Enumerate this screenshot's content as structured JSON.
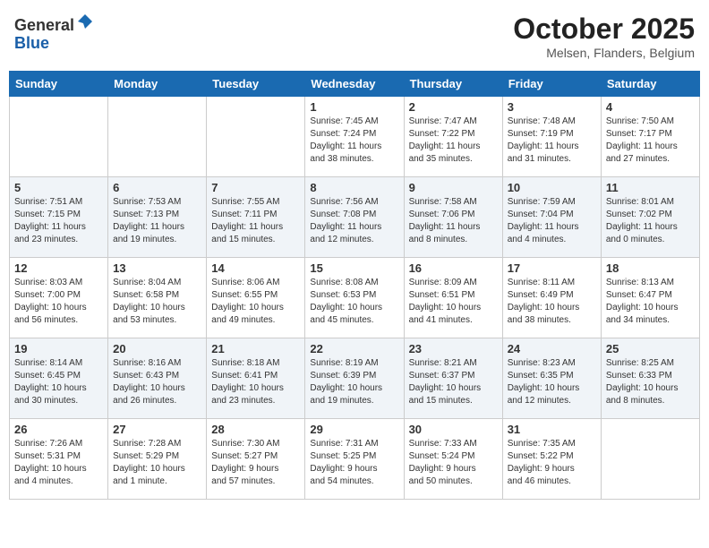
{
  "header": {
    "logo_line1": "General",
    "logo_line2": "Blue",
    "month_title": "October 2025",
    "location": "Melsen, Flanders, Belgium"
  },
  "days_of_week": [
    "Sunday",
    "Monday",
    "Tuesday",
    "Wednesday",
    "Thursday",
    "Friday",
    "Saturday"
  ],
  "weeks": [
    [
      {
        "day": "",
        "info": ""
      },
      {
        "day": "",
        "info": ""
      },
      {
        "day": "",
        "info": ""
      },
      {
        "day": "1",
        "info": "Sunrise: 7:45 AM\nSunset: 7:24 PM\nDaylight: 11 hours\nand 38 minutes."
      },
      {
        "day": "2",
        "info": "Sunrise: 7:47 AM\nSunset: 7:22 PM\nDaylight: 11 hours\nand 35 minutes."
      },
      {
        "day": "3",
        "info": "Sunrise: 7:48 AM\nSunset: 7:19 PM\nDaylight: 11 hours\nand 31 minutes."
      },
      {
        "day": "4",
        "info": "Sunrise: 7:50 AM\nSunset: 7:17 PM\nDaylight: 11 hours\nand 27 minutes."
      }
    ],
    [
      {
        "day": "5",
        "info": "Sunrise: 7:51 AM\nSunset: 7:15 PM\nDaylight: 11 hours\nand 23 minutes."
      },
      {
        "day": "6",
        "info": "Sunrise: 7:53 AM\nSunset: 7:13 PM\nDaylight: 11 hours\nand 19 minutes."
      },
      {
        "day": "7",
        "info": "Sunrise: 7:55 AM\nSunset: 7:11 PM\nDaylight: 11 hours\nand 15 minutes."
      },
      {
        "day": "8",
        "info": "Sunrise: 7:56 AM\nSunset: 7:08 PM\nDaylight: 11 hours\nand 12 minutes."
      },
      {
        "day": "9",
        "info": "Sunrise: 7:58 AM\nSunset: 7:06 PM\nDaylight: 11 hours\nand 8 minutes."
      },
      {
        "day": "10",
        "info": "Sunrise: 7:59 AM\nSunset: 7:04 PM\nDaylight: 11 hours\nand 4 minutes."
      },
      {
        "day": "11",
        "info": "Sunrise: 8:01 AM\nSunset: 7:02 PM\nDaylight: 11 hours\nand 0 minutes."
      }
    ],
    [
      {
        "day": "12",
        "info": "Sunrise: 8:03 AM\nSunset: 7:00 PM\nDaylight: 10 hours\nand 56 minutes."
      },
      {
        "day": "13",
        "info": "Sunrise: 8:04 AM\nSunset: 6:58 PM\nDaylight: 10 hours\nand 53 minutes."
      },
      {
        "day": "14",
        "info": "Sunrise: 8:06 AM\nSunset: 6:55 PM\nDaylight: 10 hours\nand 49 minutes."
      },
      {
        "day": "15",
        "info": "Sunrise: 8:08 AM\nSunset: 6:53 PM\nDaylight: 10 hours\nand 45 minutes."
      },
      {
        "day": "16",
        "info": "Sunrise: 8:09 AM\nSunset: 6:51 PM\nDaylight: 10 hours\nand 41 minutes."
      },
      {
        "day": "17",
        "info": "Sunrise: 8:11 AM\nSunset: 6:49 PM\nDaylight: 10 hours\nand 38 minutes."
      },
      {
        "day": "18",
        "info": "Sunrise: 8:13 AM\nSunset: 6:47 PM\nDaylight: 10 hours\nand 34 minutes."
      }
    ],
    [
      {
        "day": "19",
        "info": "Sunrise: 8:14 AM\nSunset: 6:45 PM\nDaylight: 10 hours\nand 30 minutes."
      },
      {
        "day": "20",
        "info": "Sunrise: 8:16 AM\nSunset: 6:43 PM\nDaylight: 10 hours\nand 26 minutes."
      },
      {
        "day": "21",
        "info": "Sunrise: 8:18 AM\nSunset: 6:41 PM\nDaylight: 10 hours\nand 23 minutes."
      },
      {
        "day": "22",
        "info": "Sunrise: 8:19 AM\nSunset: 6:39 PM\nDaylight: 10 hours\nand 19 minutes."
      },
      {
        "day": "23",
        "info": "Sunrise: 8:21 AM\nSunset: 6:37 PM\nDaylight: 10 hours\nand 15 minutes."
      },
      {
        "day": "24",
        "info": "Sunrise: 8:23 AM\nSunset: 6:35 PM\nDaylight: 10 hours\nand 12 minutes."
      },
      {
        "day": "25",
        "info": "Sunrise: 8:25 AM\nSunset: 6:33 PM\nDaylight: 10 hours\nand 8 minutes."
      }
    ],
    [
      {
        "day": "26",
        "info": "Sunrise: 7:26 AM\nSunset: 5:31 PM\nDaylight: 10 hours\nand 4 minutes."
      },
      {
        "day": "27",
        "info": "Sunrise: 7:28 AM\nSunset: 5:29 PM\nDaylight: 10 hours\nand 1 minute."
      },
      {
        "day": "28",
        "info": "Sunrise: 7:30 AM\nSunset: 5:27 PM\nDaylight: 9 hours\nand 57 minutes."
      },
      {
        "day": "29",
        "info": "Sunrise: 7:31 AM\nSunset: 5:25 PM\nDaylight: 9 hours\nand 54 minutes."
      },
      {
        "day": "30",
        "info": "Sunrise: 7:33 AM\nSunset: 5:24 PM\nDaylight: 9 hours\nand 50 minutes."
      },
      {
        "day": "31",
        "info": "Sunrise: 7:35 AM\nSunset: 5:22 PM\nDaylight: 9 hours\nand 46 minutes."
      },
      {
        "day": "",
        "info": ""
      }
    ]
  ]
}
